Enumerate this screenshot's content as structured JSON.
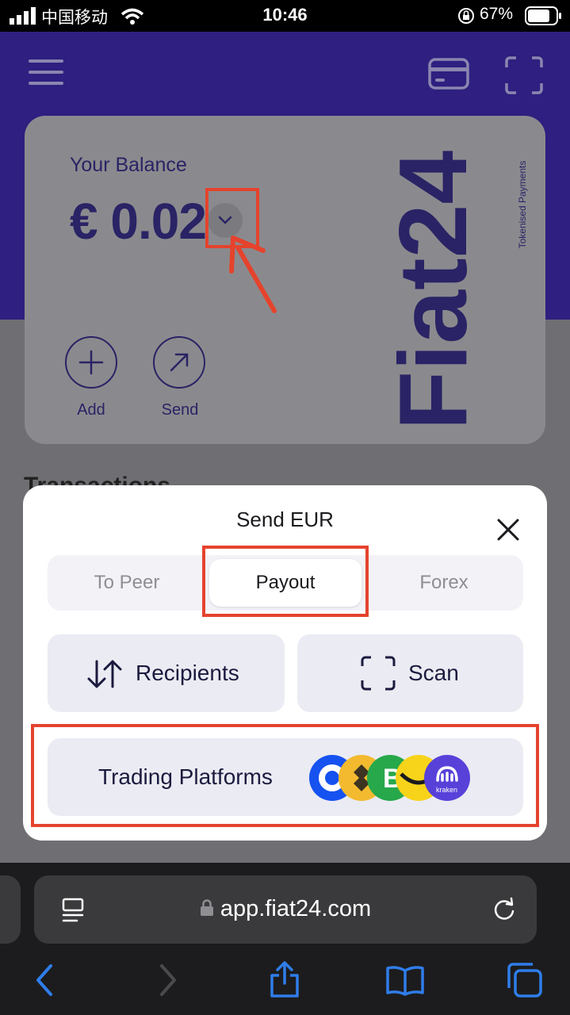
{
  "status_bar": {
    "carrier": "中国移动",
    "time": "10:46",
    "battery": "67%"
  },
  "card": {
    "balance_label": "Your Balance",
    "balance_amount": "€ 0.02",
    "brand": "Fiat24",
    "brand_tagline": "Tokenised Payments",
    "add_label": "Add",
    "send_label": "Send"
  },
  "transactions": {
    "title": "Transactions"
  },
  "modal": {
    "title": "Send EUR",
    "tabs": {
      "peer": "To Peer",
      "payout": "Payout",
      "forex": "Forex"
    },
    "recipients_label": "Recipients",
    "scan_label": "Scan",
    "trading_label": "Trading Platforms",
    "platform_icons": [
      "coinbase-icon",
      "binance-icon",
      "bitpanda-icon",
      "bybit-icon",
      "kraken-icon"
    ],
    "kraken_text": "kraken"
  },
  "browser": {
    "url": "app.fiat24.com"
  },
  "colors": {
    "brand_purple": "#2e1f80",
    "annotation_red": "#e5432d"
  }
}
